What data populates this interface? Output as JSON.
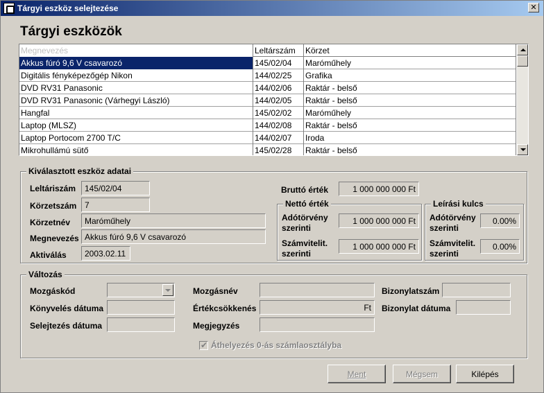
{
  "window": {
    "title": "Tárgyi eszköz selejtezése",
    "close_glyph": "✕"
  },
  "main_title": "Tárgyi eszközök",
  "list": {
    "columns": [
      "Megnevezés",
      "Leltárszám",
      "Körzet"
    ],
    "rows": [
      [
        "Akkus fúró 9,6 V csavarozó",
        "145/02/04",
        "Maróműhely"
      ],
      [
        "Digitális fényképezőgép Nikon",
        "144/02/25",
        "Grafika"
      ],
      [
        "DVD RV31 Panasonic",
        "144/02/06",
        "Raktár - belső"
      ],
      [
        "DVD RV31 Panasonic (Várhegyi László)",
        "144/02/05",
        "Raktár - belső"
      ],
      [
        "Hangfal",
        "145/02/02",
        "Maróműhely"
      ],
      [
        "Laptop (MLSZ)",
        "144/02/08",
        "Raktár - belső"
      ],
      [
        "Laptop Portocom 2700 T/C",
        "144/02/07",
        "Iroda"
      ],
      [
        "Mikrohullámú sütő",
        "145/02/28",
        "Raktár - belső"
      ]
    ]
  },
  "selected": {
    "group_label": "Kiválasztott eszköz adatai",
    "leltariszam_label": "Leltáriszám",
    "leltariszam": "145/02/04",
    "korzetszam_label": "Körzetszám",
    "korzetszam": "7",
    "korzetnev_label": "Körzetnév",
    "korzetnev": "Maróműhely",
    "megnevezes_label": "Megnevezés",
    "megnevezes": "Akkus fúró 9,6 V csavarozó",
    "aktivalas_label": "Aktiválás",
    "aktivalas": "2003.02.11",
    "brutto_label": "Bruttó érték",
    "brutto": "1 000 000 000 Ft",
    "netto_group": "Nettó érték",
    "ado_label_1": "Adótörvény",
    "ado_label_2": "szerinti",
    "netto_ado": "1 000 000 000 Ft",
    "szamv_label_1": "Számvitelit.",
    "szamv_label_2": "szerinti",
    "netto_szamv": "1 000 000 000 Ft",
    "leirasi_group": "Leírási kulcs",
    "kulcs_ado": "0.00%",
    "kulcs_szamv": "0.00%"
  },
  "valtozas": {
    "group_label": "Változás",
    "mozgaskod_label": "Mozgáskód",
    "mozgaskod": "",
    "konyveles_label": "Könyvelés dátuma",
    "konyveles": "",
    "selejtezes_label": "Selejtezés dátuma",
    "selejtezes": "",
    "mozgasnev_label": "Mozgásnév",
    "mozgasnev": "",
    "ertekcsokkenes_label": "Értékcsökkenés",
    "ertekcsokkenes": "Ft",
    "megjegyzes_label": "Megjegyzés",
    "megjegyzes": "",
    "bizonylatszam_label": "Bizonylatszám",
    "bizonylatszam": "",
    "bizonylat_datuma_label": "Bizonylat dátuma",
    "bizonylat_datuma": "",
    "athelyezes_label": "Áthelyezés 0-ás számlaosztályba",
    "athelyezes_checked": true
  },
  "buttons": {
    "ment": "Ment",
    "megsem": "Mégsem",
    "kilepes": "Kilépés"
  }
}
